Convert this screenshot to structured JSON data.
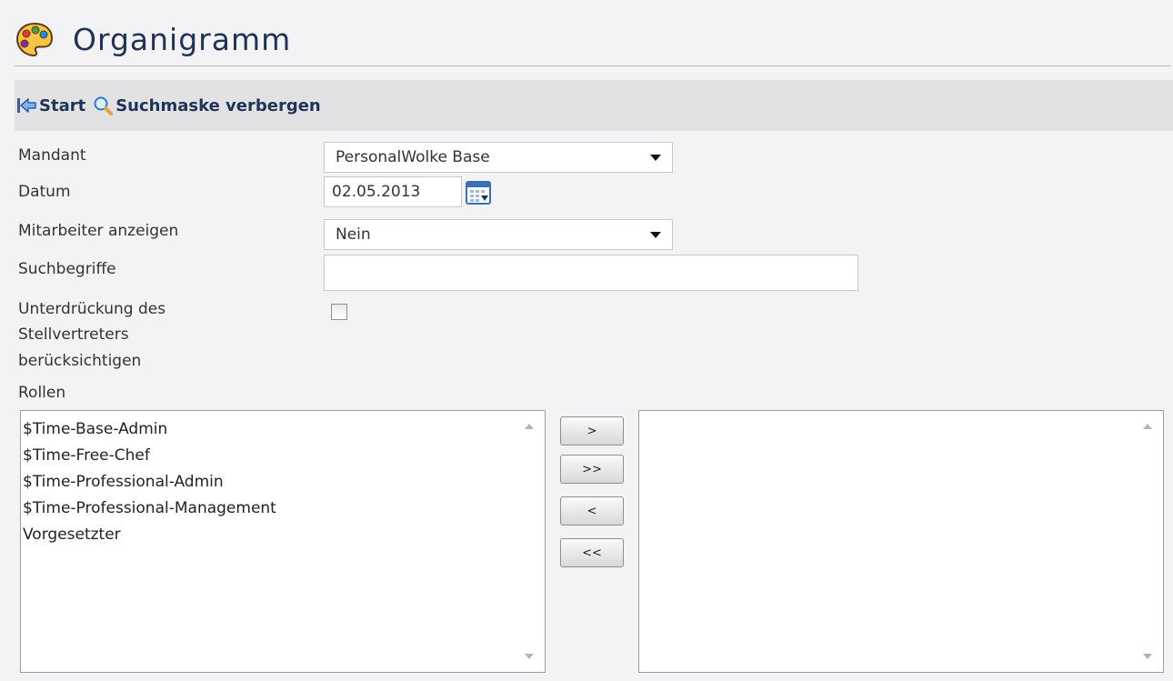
{
  "page": {
    "title": "Organigramm",
    "icon": "palette-icon"
  },
  "toolbar": {
    "start_label": "Start",
    "start_icon": "back-arrow-icon",
    "search_toggle_label": "Suchmaske verbergen",
    "search_toggle_icon": "magnifier-icon"
  },
  "form": {
    "mandant": {
      "label": "Mandant",
      "value": "PersonalWolke Base"
    },
    "datum": {
      "label": "Datum",
      "value": "02.05.2013",
      "icon": "calendar-icon"
    },
    "mitarbeiter": {
      "label": "Mitarbeiter anzeigen",
      "value": "Nein"
    },
    "suchbegriffe": {
      "label": "Suchbegriffe",
      "value": ""
    },
    "stellvertreter": {
      "label_line1": "Unterdrückung des",
      "label_line2": "Stellvertreters",
      "label_line3": "berücksichtigen",
      "checked": false
    },
    "rollen": {
      "label": "Rollen",
      "available": [
        "$Time-Base-Admin",
        "$Time-Free-Chef",
        "$Time-Professional-Admin",
        "$Time-Professional-Management",
        "Vorgesetzter"
      ],
      "selected": []
    }
  },
  "move_buttons": {
    "add": ">",
    "add_all": ">>",
    "remove": "<",
    "remove_all": "<<"
  },
  "colors": {
    "background": "#f3f3f5",
    "toolbar": "#e2e2e4",
    "title": "#1f3354"
  }
}
